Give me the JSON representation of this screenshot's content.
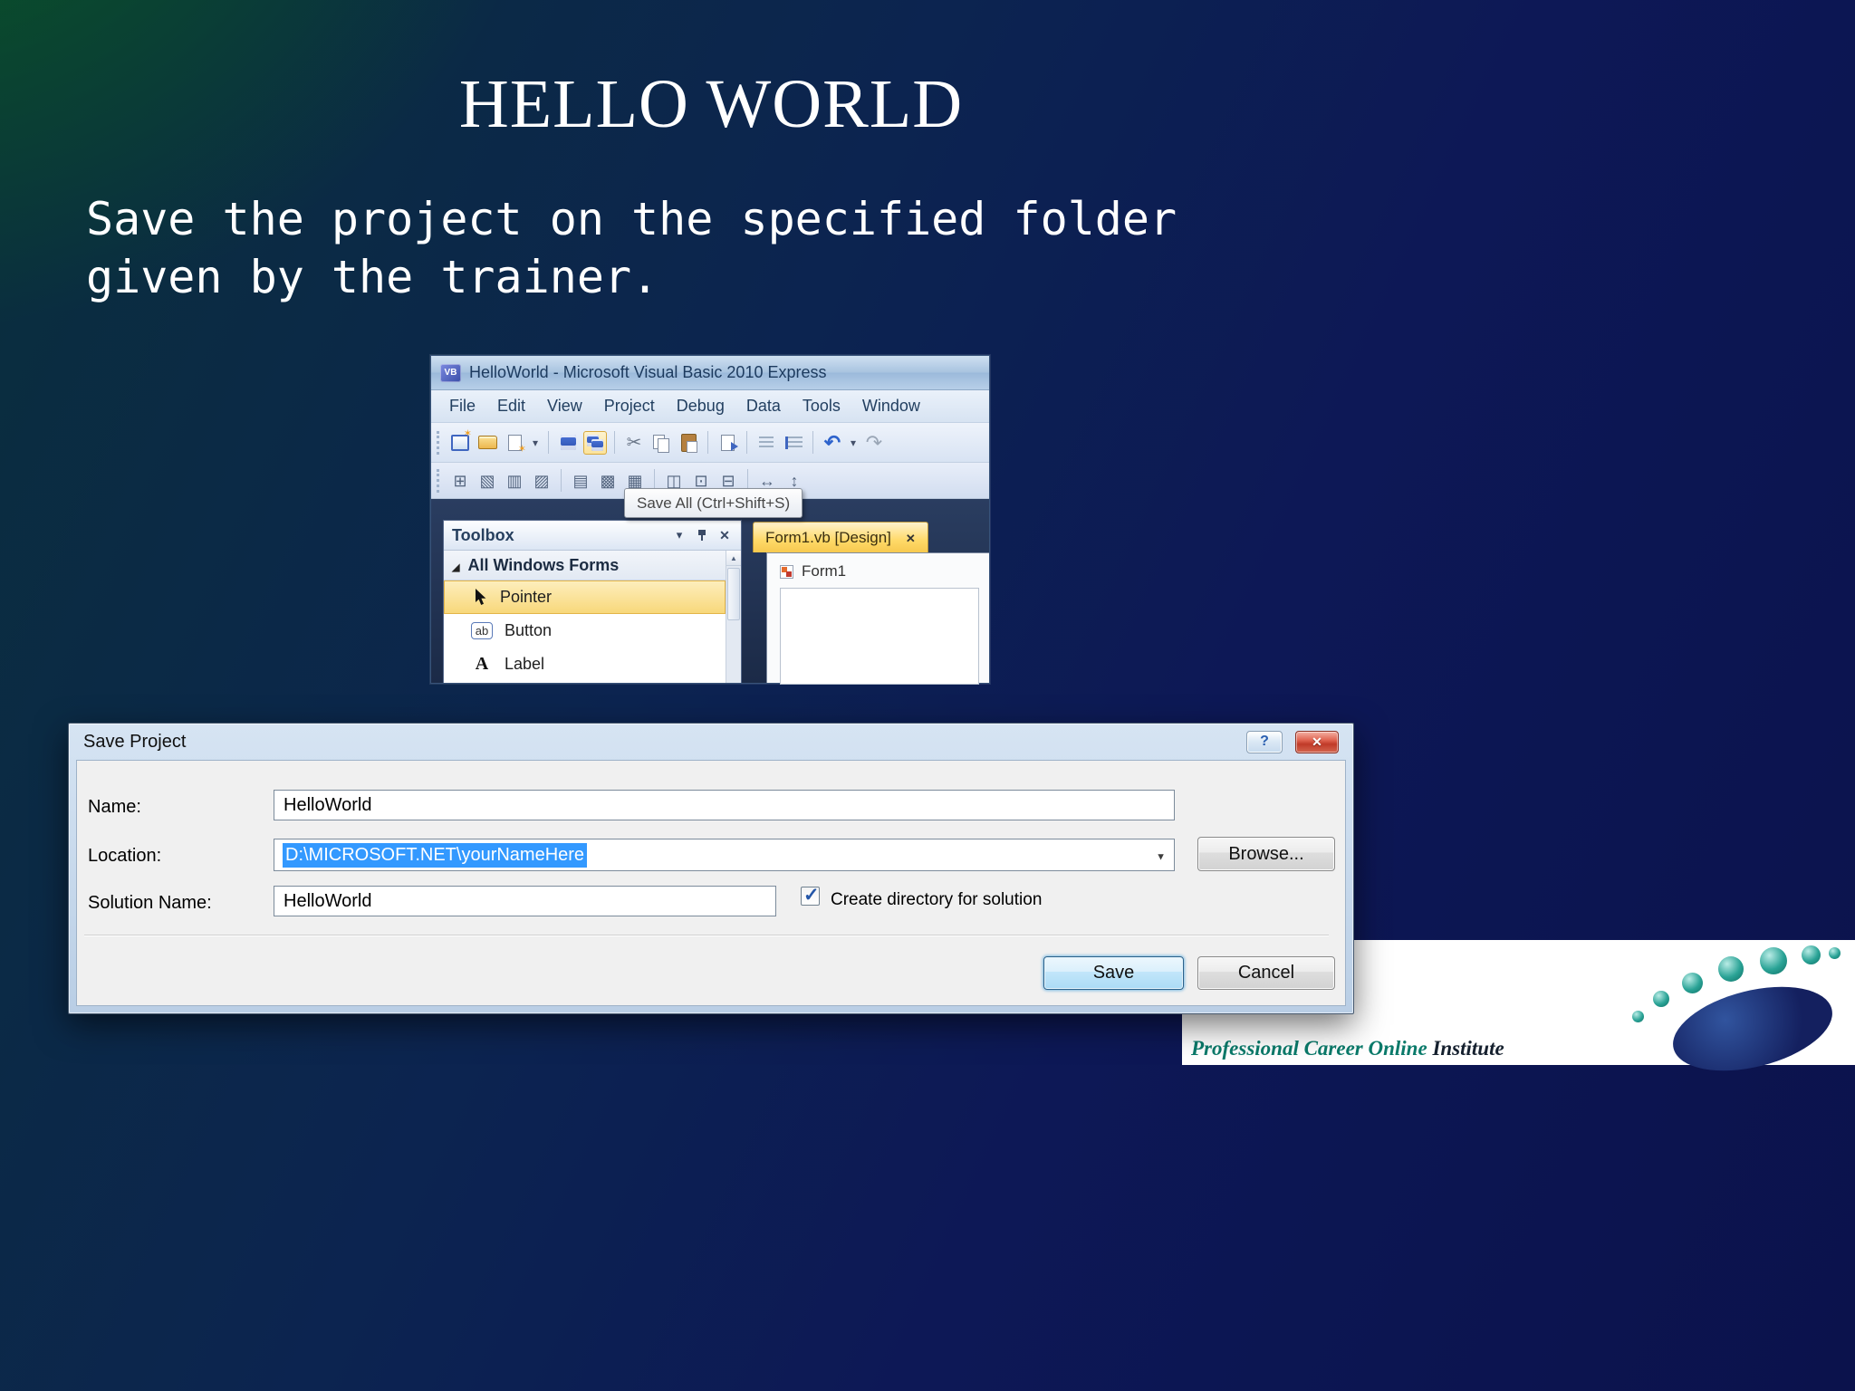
{
  "slide": {
    "title": "HELLO WORLD",
    "body": "Save the project on the specified folder\ngiven by the trainer."
  },
  "vs_window": {
    "app_icon": "VB",
    "title": "HelloWorld - Microsoft Visual Basic 2010 Express",
    "menus": [
      "File",
      "Edit",
      "View",
      "Project",
      "Debug",
      "Data",
      "Tools",
      "Window"
    ],
    "standard_toolbar_icons": [
      "new-project",
      "open-folder",
      "add-item",
      "dropdown-caret",
      "separator",
      "save",
      "save-all",
      "separator",
      "cut",
      "copy",
      "paste",
      "separator",
      "find-in-files",
      "separator",
      "comment-lines",
      "uncomment-lines",
      "separator",
      "undo",
      "dropdown-caret",
      "redo"
    ],
    "layout_toolbar_icons": [
      "snap-to-grid",
      "align-lefts",
      "align-centers",
      "align-rights",
      "separator",
      "align-tops",
      "align-middles",
      "align-bottoms",
      "separator",
      "same-width",
      "same-size",
      "same-height",
      "separator",
      "horizontal-spacing",
      "vertical-spacing"
    ],
    "tooltip": "Save All (Ctrl+Shift+S)",
    "toolbox": {
      "title": "Toolbox",
      "group": "All Windows Forms",
      "items": [
        {
          "name": "Pointer",
          "selected": true
        },
        {
          "name": "Button",
          "icon_text": "ab"
        },
        {
          "name": "Label",
          "icon_text": "A"
        }
      ]
    },
    "designer": {
      "tab": "Form1.vb [Design]",
      "form_title": "Form1"
    }
  },
  "save_dialog": {
    "title": "Save Project",
    "name_label": "Name:",
    "name_value": "HelloWorld",
    "location_label": "Location:",
    "location_value": "D:\\MICROSOFT.NET\\yourNameHere",
    "browse_label": "Browse...",
    "solution_label": "Solution Name:",
    "solution_value": "HelloWorld",
    "checkbox_label": "Create directory for solution",
    "checkbox_checked": true,
    "save_label": "Save",
    "cancel_label": "Cancel"
  },
  "logo": {
    "text_primary": "Professional Career Online ",
    "text_secondary": "Institute"
  },
  "colors": {
    "selection_blue": "#3399ff",
    "active_tab_yellow": "#ffd968",
    "toolbox_highlight": "#f8d87b",
    "logo_teal": "#0a7a6a",
    "logo_navy": "#14205f"
  }
}
